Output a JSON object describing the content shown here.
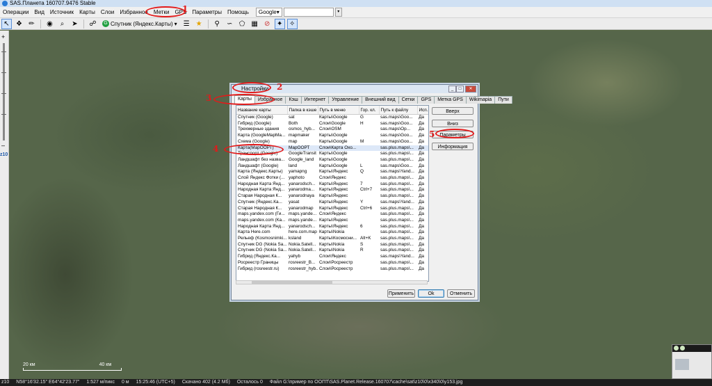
{
  "window": {
    "title": "SAS.Планета 160707.9476 Stable"
  },
  "menu": {
    "items": [
      "Операции",
      "Вид",
      "Источник",
      "Карты",
      "Слои",
      "Избранное",
      "Метки",
      "GPS",
      "Параметры",
      "Помощь"
    ],
    "search_provider": "Google"
  },
  "toolbar": {
    "map_combo": "Спутник (Яндекс.Карты)"
  },
  "leftpanel": {
    "zoom_label": "z10"
  },
  "map": {
    "scale_left": "20 км",
    "scale_right": "40 км"
  },
  "statusbar": {
    "zoom": "z10",
    "coords": "N58°16'32.15\" E64°42'23.77\"",
    "scale": "1:527 м/пикс",
    "distance": "0 м",
    "time": "15:25:46 (UTC+5)",
    "downloaded": "Скачано 402 (4.2 Мб)",
    "remaining": "Осталось 0",
    "file": "Файл G:\\пример по ООПТ\\SAS.Planet.Release.160707\\cache\\sat\\z10\\0\\x340\\0\\y153.jpg"
  },
  "dialog": {
    "title": "Настройки",
    "tabs": [
      "Карты",
      "Избранное",
      "Кэш",
      "Интернет",
      "Управление",
      "Внешний вид",
      "Сетки",
      "GPS",
      "Метка GPS",
      "Wikimapia",
      "Пути"
    ],
    "active_tab": "Карты",
    "columns": [
      "Название карты",
      "Папка в кэше",
      "Путь в меню",
      "Гор. кл.",
      "Путь к файлу",
      "Исп..."
    ],
    "rows": [
      [
        "Спутник (Google)",
        "sat",
        "Карты\\Google",
        "G",
        "sas.maps\\Goo...",
        "Да"
      ],
      [
        "Гибрид (Google)",
        "Both",
        "Слои\\Google",
        "H",
        "sas.maps\\Goo...",
        "Да"
      ],
      [
        "Трехмерные здания",
        "osmos_hyb...",
        "Слои\\OSM",
        "",
        "sas.maps\\Op...",
        "Да"
      ],
      [
        "Карта (GoogleMapMa...",
        "mapmaker",
        "Карты\\Google",
        "",
        "sas.maps\\Goo...",
        "Да"
      ],
      [
        "Схема (Google)",
        "map",
        "Карты\\Google",
        "M",
        "sas.maps\\Goo...",
        "Да"
      ],
      [
        "Карта(МарООРТ)",
        "МарООРТ",
        "Слои\\Карта Охо...",
        "",
        "sas.plus.maps\\...",
        "Да"
      ],
      [
        "Транспорт (Google)",
        "GoogleTransit",
        "Карты\\Google",
        "",
        "sas.plus.maps\\...",
        "Да"
      ],
      [
        "Ландшафт без назва...",
        "Google_land",
        "Карты\\Google",
        "",
        "sas.plus.maps\\...",
        "Да"
      ],
      [
        "Ландшафт (Google)",
        "land",
        "Карты\\Google",
        "L",
        "sas.maps\\Goo...",
        "Да"
      ],
      [
        "Карта (Яндекс.Карты)",
        "yamapng",
        "Карты\\Яндекс",
        "Q",
        "sas.maps\\Yand...",
        "Да"
      ],
      [
        "Слой Яндекс Фотки (...",
        "yaphoto",
        "Слои\\Яндекс",
        "",
        "sas.plus.maps\\...",
        "Да"
      ],
      [
        "Народная Карта Янд...",
        "yanarodsch...",
        "Карты\\Яндекс",
        "7",
        "sas.plus.maps\\...",
        "Да"
      ],
      [
        "Народная Карта Янд...",
        "yanarodma...",
        "Карты\\Яндекс",
        "Ctrl+7",
        "sas.plus.maps\\...",
        "Да"
      ],
      [
        "Старая Народная К...",
        "yanarodnaya",
        "Карты\\Яндекс",
        "",
        "sas.plus.maps\\...",
        "Да"
      ],
      [
        "Спутник (Яндекс.Ка...",
        "yasat",
        "Карты\\Яндекс",
        "Y",
        "sas.maps\\Yand...",
        "Да"
      ],
      [
        "Старая Народная К...",
        "yanarodmap",
        "Карты\\Яндекс",
        "Ctrl+6",
        "sas.plus.maps\\...",
        "Да"
      ],
      [
        "maps.yandex.com (Ги...",
        "maps.yande...",
        "Слои\\Яндекс",
        "",
        "sas.plus.maps\\...",
        "Да"
      ],
      [
        "maps.yandex.com (Ка...",
        "maps.yande...",
        "Карты\\Яндекс",
        "",
        "sas.plus.maps\\...",
        "Да"
      ],
      [
        "Народная Карта Янд...",
        "yanarodsch...",
        "Карты\\Яндекс",
        "6",
        "sas.plus.maps\\...",
        "Да"
      ],
      [
        "Карта Here.com",
        "here.com.map",
        "Карты\\Nokia",
        "",
        "sas.plus.maps\\...",
        "Да"
      ],
      [
        "Рельеф (Kosmosnimki...",
        "ksland",
        "Карты\\Космосни...",
        "Alt+K",
        "sas.plus.maps\\...",
        "Да"
      ],
      [
        "Спутник DG (Nokia Sa...",
        "Nokia.Satell...",
        "Карты\\Nokia",
        "S",
        "sas.plus.maps\\...",
        "Да"
      ],
      [
        "Спутник DG (Nokia Sa...",
        "Nokia.Satell...",
        "Карты\\Nokia",
        "R",
        "sas.plus.maps\\...",
        "Да"
      ],
      [
        "Гибрид (Яндекс.Ка...",
        "yahyb",
        "Слои\\Яндекс",
        "",
        "sas.maps\\Yand...",
        "Да"
      ],
      [
        "Росреестр Границы",
        "rosreestr_B...",
        "Слои\\Росреестр",
        "",
        "sas.plus.maps\\...",
        "Да"
      ],
      [
        "Гибрид (rosreestr.ru)",
        "rosreestr_hyb...",
        "Слои\\Росреестр",
        "",
        "sas.plus.maps\\...",
        "Да"
      ]
    ],
    "selected_row": 5,
    "side_buttons": {
      "up": "Вверх",
      "down": "Вниз",
      "params": "Параметры",
      "info": "Информация"
    },
    "buttons": {
      "apply": "Применить",
      "ok": "Ok",
      "cancel": "Отменить"
    }
  },
  "annotations": [
    "1",
    "2",
    "3",
    "4",
    "5"
  ],
  "accent": "#e21a1a"
}
